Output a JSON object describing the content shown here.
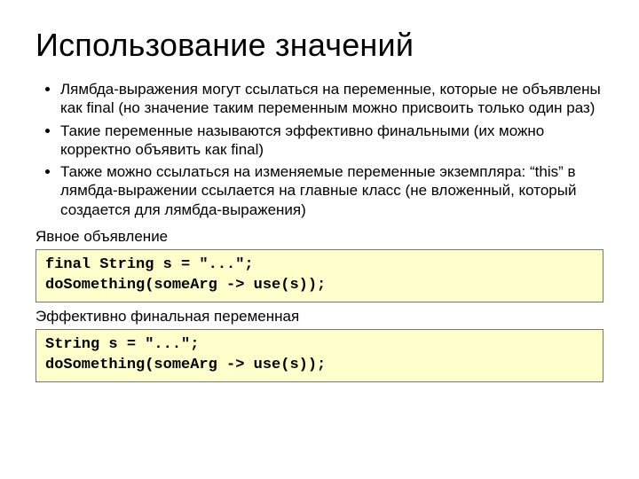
{
  "title": "Использование значений",
  "bullets": [
    "Лямбда-выражения могут ссылаться на переменные, которые не объявлены как final (но значение таким переменным можно присвоить только один раз)",
    "Такие переменные называются эффективно финальными (их можно корректно объявить как final)",
    "Также можно ссылаться на изменяемые переменные экземпляра: “this” в лямбда-выражении ссылается на главные класс (не вложенный, который создается для лямбда-выражения)"
  ],
  "label1": "Явное объявление",
  "code1": "final String s = \"...\";\ndoSomething(someArg -> use(s));",
  "label2": "Эффективно финальная переменная",
  "code2": "String s = \"...\";\ndoSomething(someArg -> use(s));"
}
